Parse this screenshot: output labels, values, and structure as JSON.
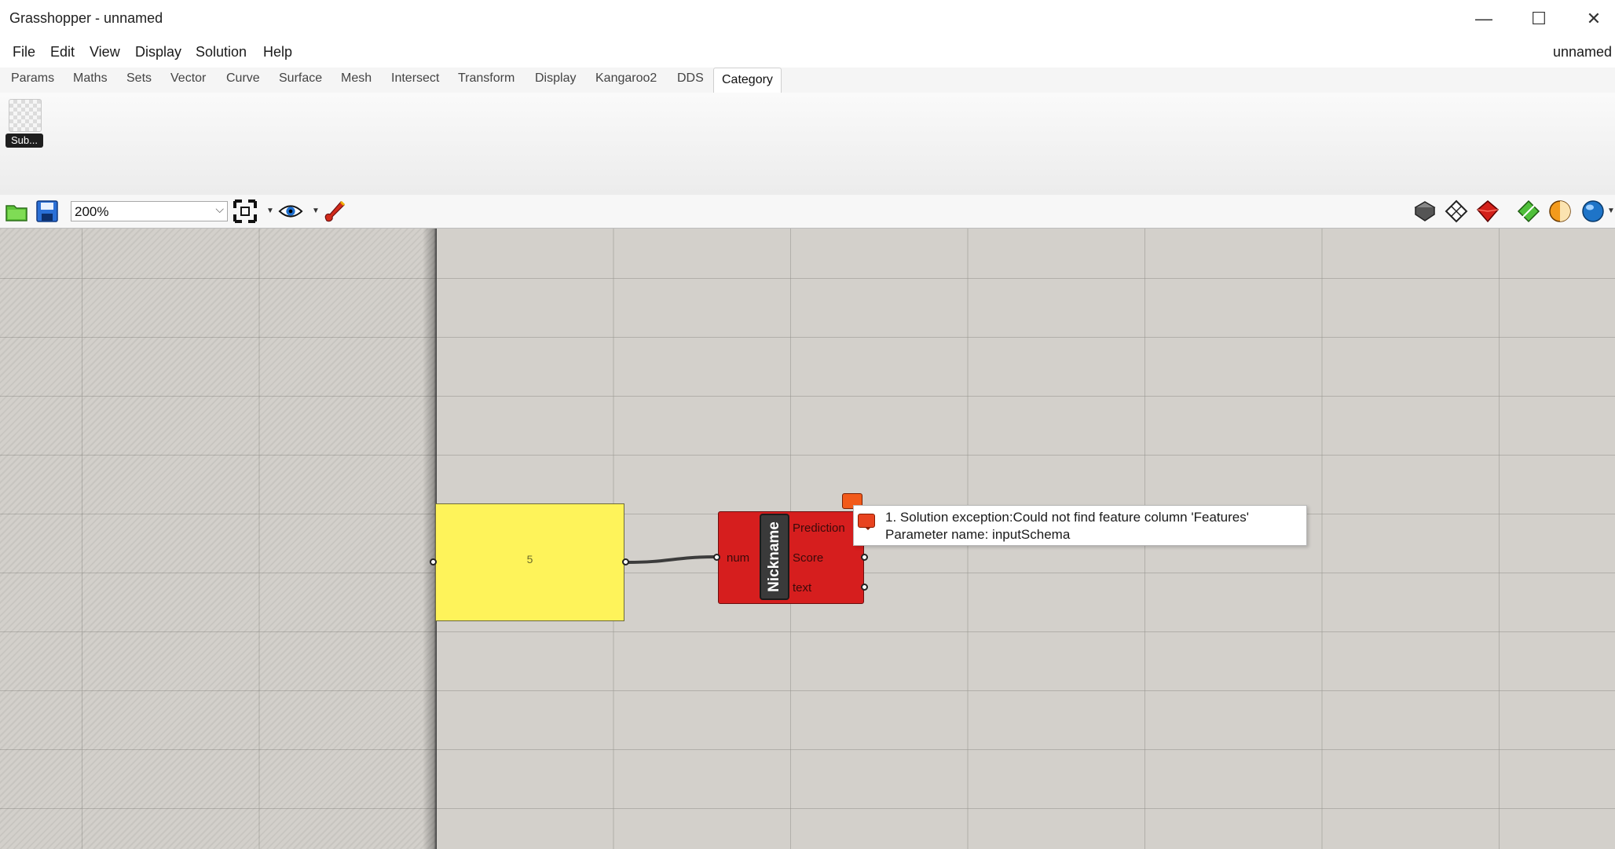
{
  "window": {
    "title": "Grasshopper - unnamed",
    "minimize_glyph": "—",
    "maximize_glyph": "☐",
    "close_glyph": "✕"
  },
  "menu": {
    "items": [
      "File",
      "Edit",
      "View",
      "Display",
      "Solution",
      "Help"
    ],
    "document_name": "unnamed"
  },
  "tabs": {
    "items": [
      "Params",
      "Maths",
      "Sets",
      "Vector",
      "Curve",
      "Surface",
      "Mesh",
      "Intersect",
      "Transform",
      "Display",
      "Kangaroo2",
      "DDS",
      "Category"
    ],
    "active": "Category"
  },
  "ribbon": {
    "components": [
      {
        "label": "Sub...",
        "icon": "checker-icon"
      }
    ]
  },
  "toolbar": {
    "zoom": "200%",
    "left_icons": [
      "open-file-icon",
      "save-file-icon"
    ],
    "mid_icons": [
      "zoom-extents-icon",
      "preview-eye-icon",
      "sketch-brush-icon"
    ],
    "right_icons": [
      "preview-off-icon",
      "preview-wireframe-icon",
      "preview-shaded-icon",
      "preview-selected-icon",
      "shading-sphere-icon",
      "sphere-blue-icon"
    ]
  },
  "canvas": {
    "panel": {
      "value": "5",
      "color": "#fef35a"
    },
    "component": {
      "nickname": "Nickname",
      "inputs": [
        "num"
      ],
      "outputs": [
        "Prediction",
        "Score",
        "text"
      ],
      "state": "error",
      "color": "#d61e1e"
    },
    "tooltip": {
      "line1": "1. Solution exception:Could not find feature column 'Features'",
      "line2": "Parameter name: inputSchema"
    }
  }
}
